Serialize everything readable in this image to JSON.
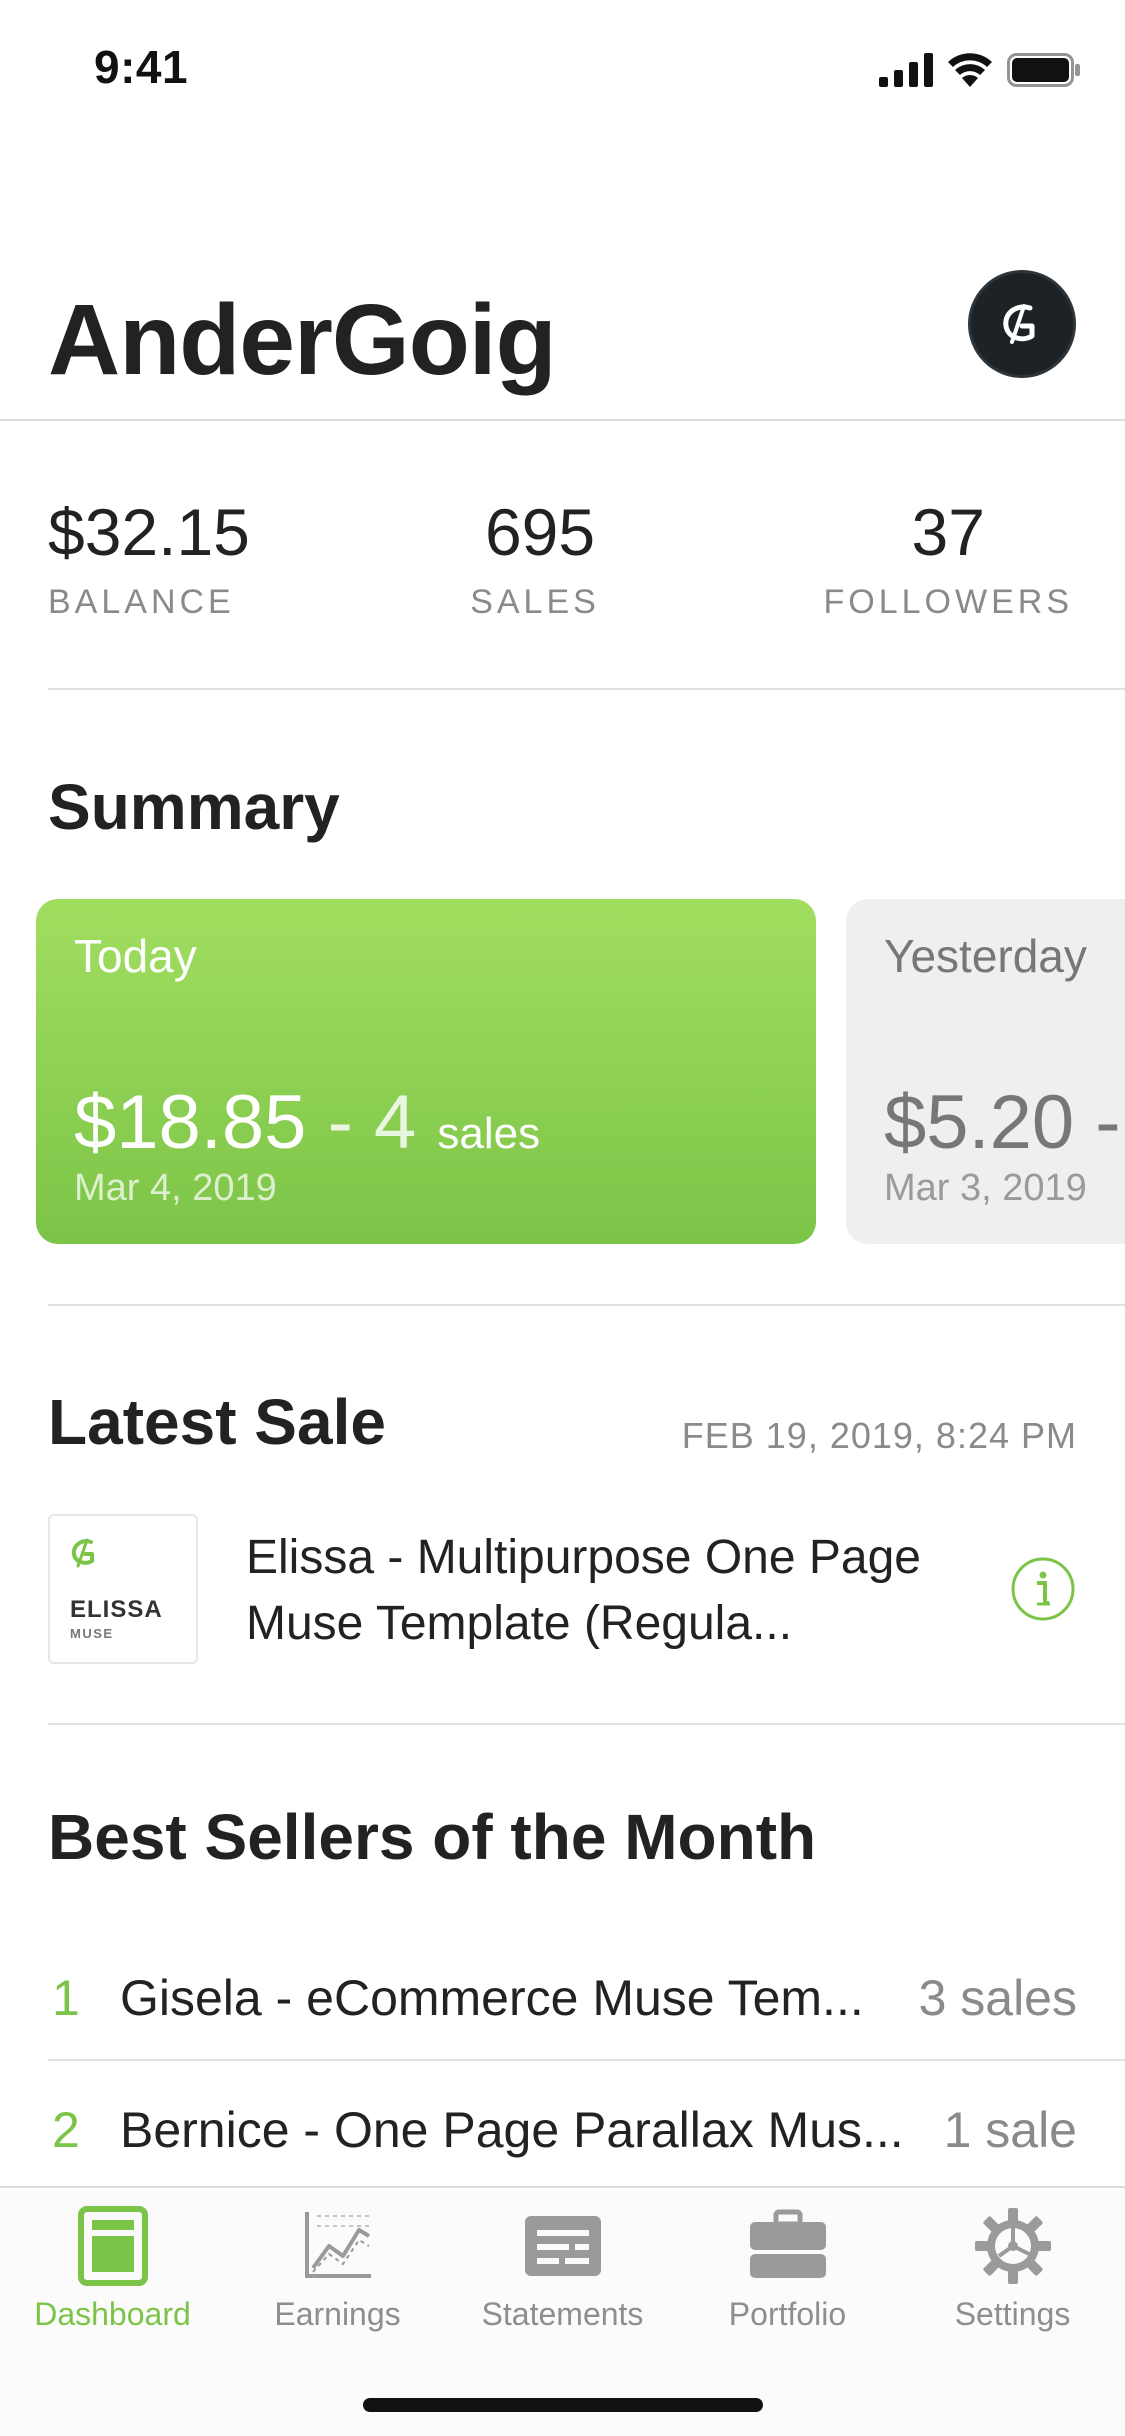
{
  "status_bar": {
    "time": "9:41"
  },
  "header": {
    "title": "AnderGoig"
  },
  "stats": [
    {
      "value": "$32.15",
      "label": "BALANCE"
    },
    {
      "value": "695",
      "label": "SALES"
    },
    {
      "value": "37",
      "label": "FOLLOWERS"
    }
  ],
  "summary": {
    "title": "Summary",
    "today": {
      "label": "Today",
      "amount": "$18.85",
      "separator": " - ",
      "count": "4",
      "unit": "sales",
      "date": "Mar 4, 2019"
    },
    "yesterday": {
      "label": "Yesterday",
      "amount": "$5.20 -",
      "date": "Mar 3, 2019"
    }
  },
  "latest_sale": {
    "title": "Latest Sale",
    "date": "FEB 19, 2019, 8:24 PM",
    "product": "Elissa - Multipurpose One Page Muse Template (Regula...",
    "thumb_name": "ELISSA",
    "thumb_sub": "MUSE"
  },
  "best_sellers": {
    "title": "Best Sellers of the Month",
    "items": [
      {
        "rank": "1",
        "name": "Gisela - eCommerce Muse Tem...",
        "count": "3 sales"
      },
      {
        "rank": "2",
        "name": "Bernice - One Page Parallax Mus...",
        "count": "1 sale"
      }
    ]
  },
  "tabs": [
    {
      "label": "Dashboard",
      "icon": "dashboard-icon",
      "active": true
    },
    {
      "label": "Earnings",
      "icon": "earnings-chart-icon",
      "active": false
    },
    {
      "label": "Statements",
      "icon": "statements-icon",
      "active": false
    },
    {
      "label": "Portfolio",
      "icon": "portfolio-icon",
      "active": false
    },
    {
      "label": "Settings",
      "icon": "gear-icon",
      "active": false
    }
  ],
  "colors": {
    "accent": "#7cc448",
    "accent_light": "#a1de60",
    "text": "#222222",
    "muted": "#8a8a8a"
  }
}
